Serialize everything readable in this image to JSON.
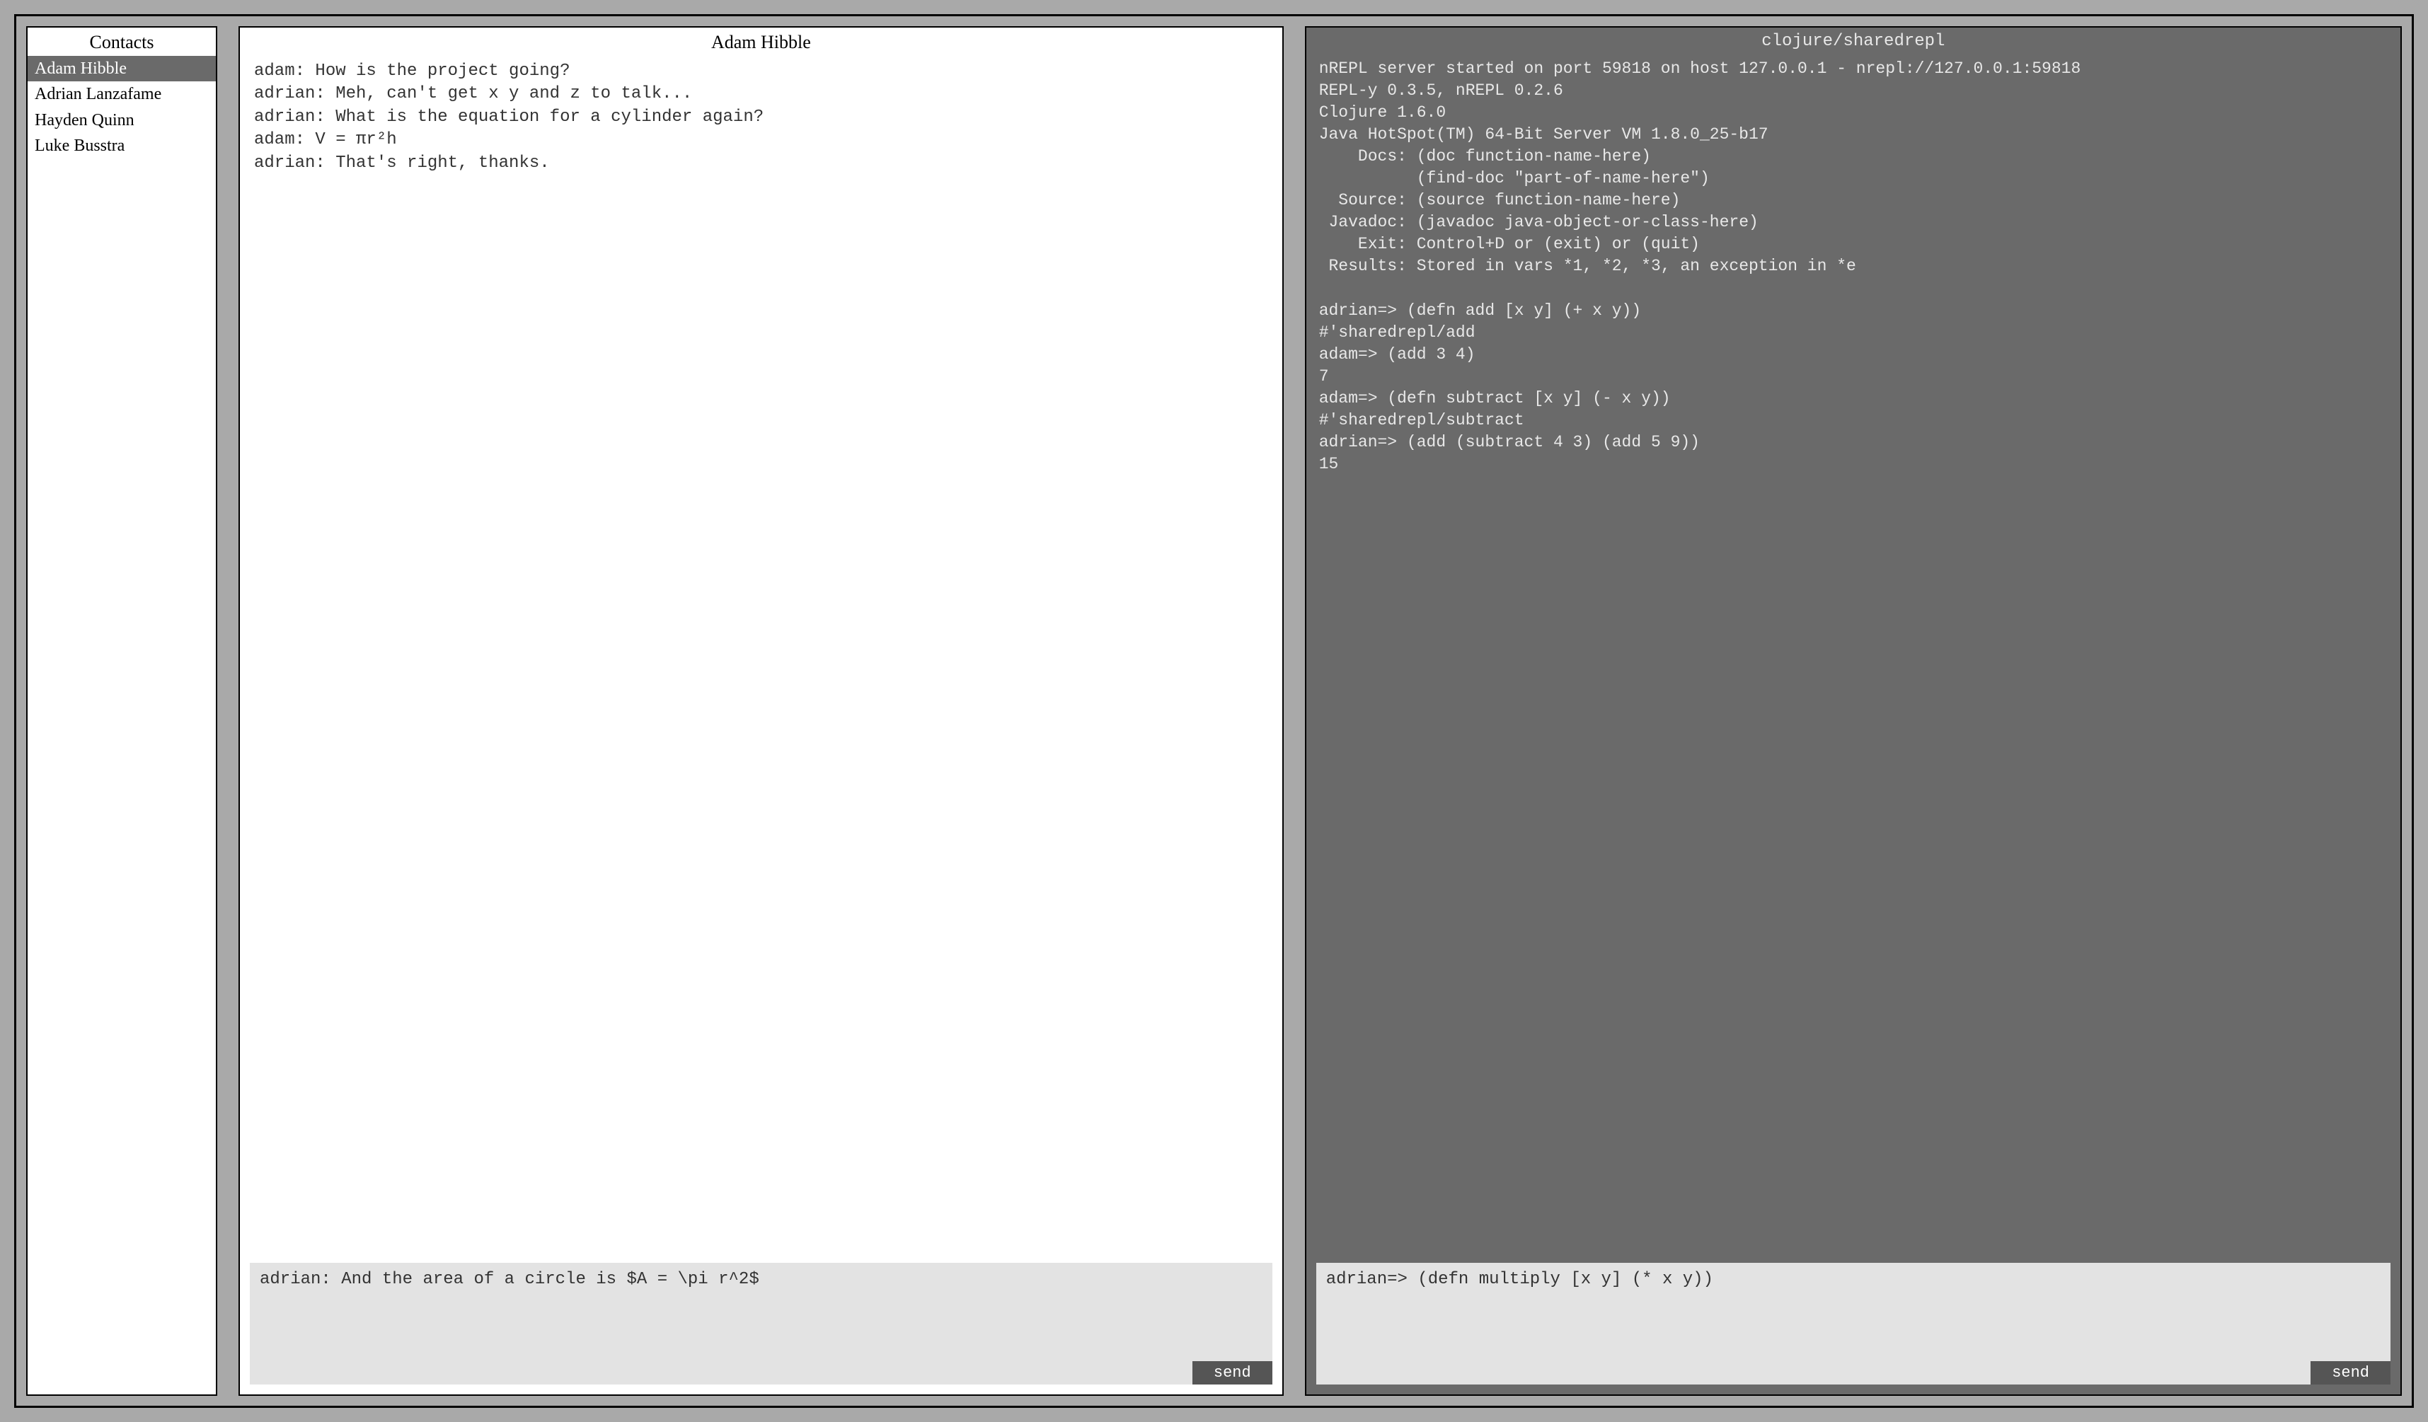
{
  "contacts": {
    "title": "Contacts",
    "items": [
      {
        "name": "Adam Hibble",
        "selected": true
      },
      {
        "name": "Adrian Lanzafame",
        "selected": false
      },
      {
        "name": "Hayden Quinn",
        "selected": false
      },
      {
        "name": "Luke Busstra",
        "selected": false
      }
    ]
  },
  "chat": {
    "title": "Adam Hibble",
    "messages": [
      "adam: How is the project going?",
      "adrian: Meh, can't get x y and z to talk...",
      "adrian: What is the equation for a cylinder again?",
      "adam: V = πr²h",
      "adrian: That's right, thanks."
    ],
    "input_value": "adrian: And the area of a circle is $A = \\pi r^2$",
    "send_label": "send"
  },
  "repl": {
    "title": "clojure/sharedrepl",
    "output": "nREPL server started on port 59818 on host 127.0.0.1 - nrepl://127.0.0.1:59818\nREPL-y 0.3.5, nREPL 0.2.6\nClojure 1.6.0\nJava HotSpot(TM) 64-Bit Server VM 1.8.0_25-b17\n    Docs: (doc function-name-here)\n          (find-doc \"part-of-name-here\")\n  Source: (source function-name-here)\n Javadoc: (javadoc java-object-or-class-here)\n    Exit: Control+D or (exit) or (quit)\n Results: Stored in vars *1, *2, *3, an exception in *e\n\nadrian=> (defn add [x y] (+ x y))\n#'sharedrepl/add\nadam=> (add 3 4)\n7\nadam=> (defn subtract [x y] (- x y))\n#'sharedrepl/subtract\nadrian=> (add (subtract 4 3) (add 5 9))\n15",
    "input_value": "adrian=> (defn multiply [x y] (* x y))",
    "send_label": "send"
  }
}
